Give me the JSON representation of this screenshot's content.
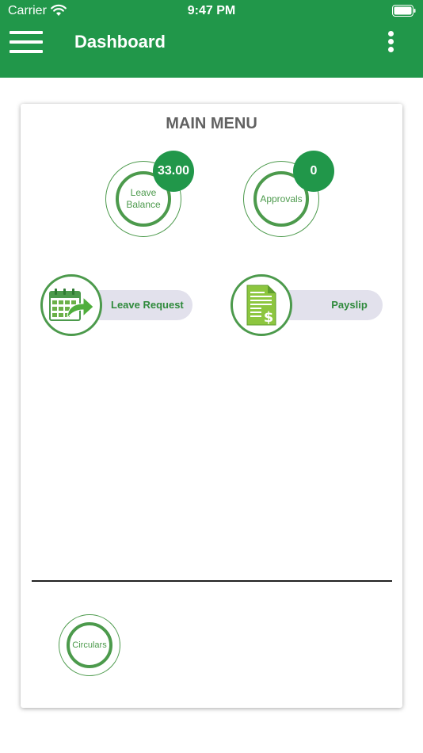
{
  "status_bar": {
    "carrier": "Carrier",
    "time": "9:47 PM"
  },
  "header": {
    "title": "Dashboard"
  },
  "main_menu": {
    "title": "MAIN MENU",
    "leave_balance": {
      "label_line1": "Leave",
      "label_line2": "Balance",
      "badge": "33.00"
    },
    "approvals": {
      "label": "Approvals",
      "badge": "0"
    },
    "leave_request": {
      "label": "Leave Request",
      "icon": "calendar-arrow-icon"
    },
    "payslip": {
      "label": "Payslip",
      "icon": "payslip-document-icon"
    }
  },
  "circulars": {
    "label": "Circulars"
  },
  "colors": {
    "primary": "#21974a",
    "ring": "#4c9a4c",
    "pill": "#e2e1ec",
    "title_gray": "#616161"
  }
}
